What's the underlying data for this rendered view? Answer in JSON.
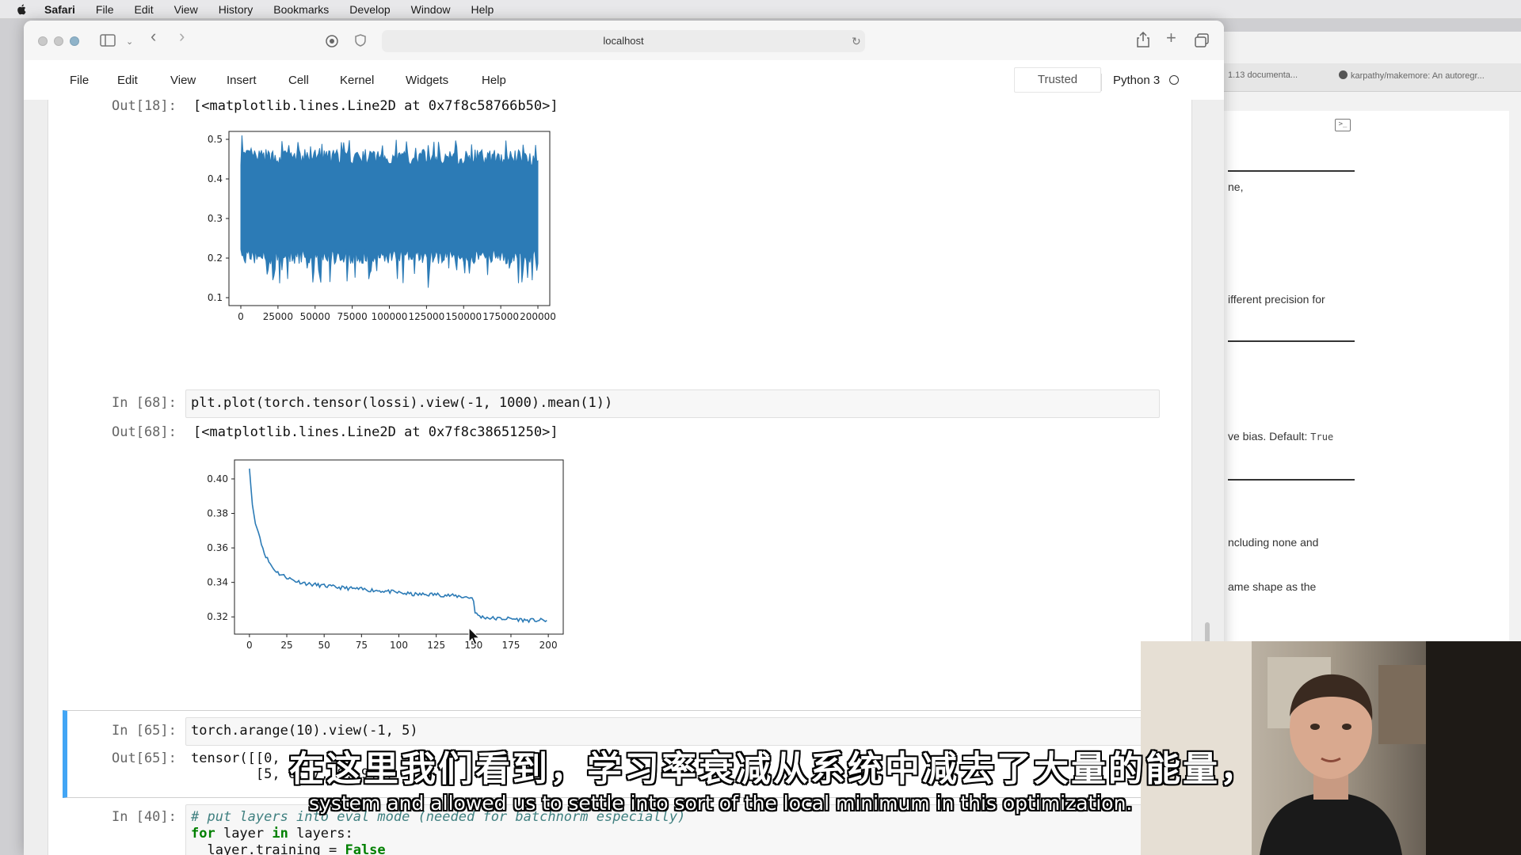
{
  "macos_menu": {
    "app": "Safari",
    "items": [
      "File",
      "Edit",
      "View",
      "History",
      "Bookmarks",
      "Develop",
      "Window",
      "Help"
    ]
  },
  "browser": {
    "address": "localhost"
  },
  "background_window": {
    "tabs": [
      "1.13 documenta...",
      "karpathy/makemore: An autoregr..."
    ],
    "doc_fragments": [
      "ne,",
      "ifferent precision for",
      "ve bias. Default: ",
      "ncluding none and",
      "ame shape as the"
    ],
    "default_value": "True"
  },
  "jupyter": {
    "menu": [
      "File",
      "Edit",
      "View",
      "Insert",
      "Cell",
      "Kernel",
      "Widgets",
      "Help"
    ],
    "trusted": "Trusted",
    "kernel": "Python 3"
  },
  "cells": {
    "out18": {
      "prompt": "Out[18]:",
      "text": "[<matplotlib.lines.Line2D at 0x7f8c58766b50>]"
    },
    "in68": {
      "prompt": "In [68]:",
      "code": "plt.plot(torch.tensor(lossi).view(-1, 1000).mean(1))"
    },
    "out68": {
      "prompt": "Out[68]:",
      "text": "[<matplotlib.lines.Line2D at 0x7f8c38651250>]"
    },
    "in65": {
      "prompt": "In [65]:",
      "code": "torch.arange(10).view(-1, 5)"
    },
    "out65": {
      "prompt": "Out[65]:",
      "line1": "tensor([[0,",
      "line2": "        [5, 6, 7, 8, 9]])"
    },
    "in40": {
      "prompt": "In [40]:",
      "comment": "# put layers into eval mode (needed for batchnorm especially)",
      "line2_kw1": "for",
      "line2_mid": " layer ",
      "line2_kw2": "in",
      "line2_end": " layers:",
      "line3": "  layer.training = ",
      "line3_val": "False"
    }
  },
  "chart_data": [
    {
      "type": "line",
      "title": "",
      "xlabel": "",
      "ylabel": "",
      "xlim": [
        -8000,
        208000
      ],
      "ylim": [
        0.08,
        0.52
      ],
      "x_ticks": [
        "0",
        "25000",
        "50000",
        "75000",
        "100000",
        "125000",
        "150000",
        "175000",
        "200000"
      ],
      "y_ticks": [
        "0.1",
        "0.2",
        "0.3",
        "0.4",
        "0.5"
      ],
      "x_tick_values": [
        0,
        25000,
        50000,
        75000,
        100000,
        125000,
        150000,
        175000,
        200000
      ],
      "y_tick_values": [
        0.1,
        0.2,
        0.3,
        0.4,
        0.5
      ],
      "color": "#2c7bb6",
      "series": [
        {
          "x_start": 0,
          "x_end": 200000,
          "upper_envelope_mean": 0.455,
          "lower_envelope_mean": 0.205,
          "max": 0.51,
          "min": 0.125
        }
      ]
    },
    {
      "type": "line",
      "title": "",
      "xlabel": "",
      "ylabel": "",
      "xlim": [
        -10,
        210
      ],
      "ylim": [
        0.31,
        0.411
      ],
      "x_ticks": [
        "0",
        "25",
        "50",
        "75",
        "100",
        "125",
        "150",
        "175",
        "200"
      ],
      "y_ticks": [
        "0.32",
        "0.34",
        "0.36",
        "0.38",
        "0.40"
      ],
      "x_tick_values": [
        0,
        25,
        50,
        75,
        100,
        125,
        150,
        175,
        200
      ],
      "y_tick_values": [
        0.32,
        0.34,
        0.36,
        0.38,
        0.4
      ],
      "color": "#2c7bb6",
      "series": [
        {
          "x": [
            0,
            1,
            2,
            4,
            6,
            8,
            10,
            13,
            16,
            20,
            25,
            30,
            40,
            50,
            60,
            75,
            90,
            100,
            110,
            125,
            140,
            149,
            150,
            151,
            155,
            165,
            175,
            185,
            190,
            199
          ],
          "y": [
            0.406,
            0.395,
            0.385,
            0.374,
            0.369,
            0.363,
            0.357,
            0.352,
            0.348,
            0.345,
            0.343,
            0.341,
            0.339,
            0.338,
            0.337,
            0.336,
            0.335,
            0.334,
            0.333,
            0.333,
            0.332,
            0.331,
            0.33,
            0.322,
            0.32,
            0.319,
            0.319,
            0.318,
            0.318,
            0.318
          ]
        }
      ]
    }
  ],
  "subtitles": {
    "zh": "在这里我们看到，学习率衰减从系统中减去了大量的能量，",
    "en": "system and allowed us to settle into sort of the local minimum in this optimization."
  }
}
